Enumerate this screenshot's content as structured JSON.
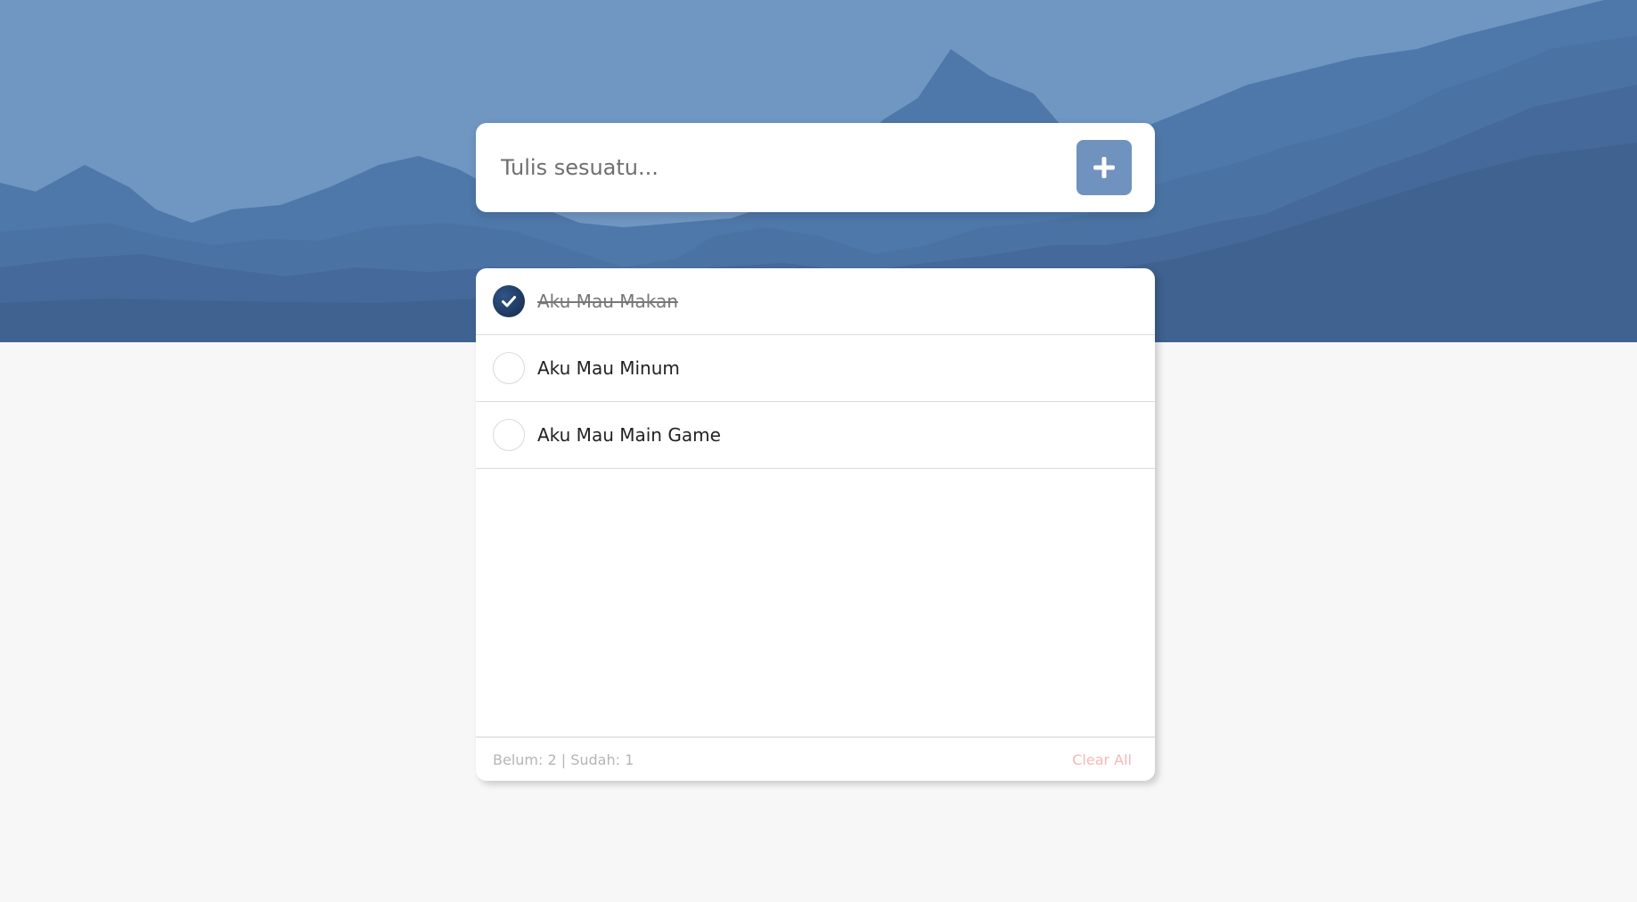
{
  "colors": {
    "sky": "#7096c2",
    "mountain_light": "#4d77a8",
    "mountain_mid": "#456e9f",
    "mountain_dark": "#3d5f8b",
    "add_button": "#6f92bf",
    "checked": "#1d3558",
    "clear_all": "#f6b7b7",
    "page_bg": "#f7f7f7"
  },
  "input": {
    "placeholder": "Tulis sesuatu...",
    "value": "",
    "add_icon": "plus-icon"
  },
  "todos": [
    {
      "text": "Aku Mau Makan",
      "done": true
    },
    {
      "text": "Aku Mau Minum",
      "done": false
    },
    {
      "text": "Aku Mau Main Game",
      "done": false
    }
  ],
  "footer": {
    "status": "Belum: 2 | Sudah: 1",
    "clear_all": "Clear All"
  }
}
